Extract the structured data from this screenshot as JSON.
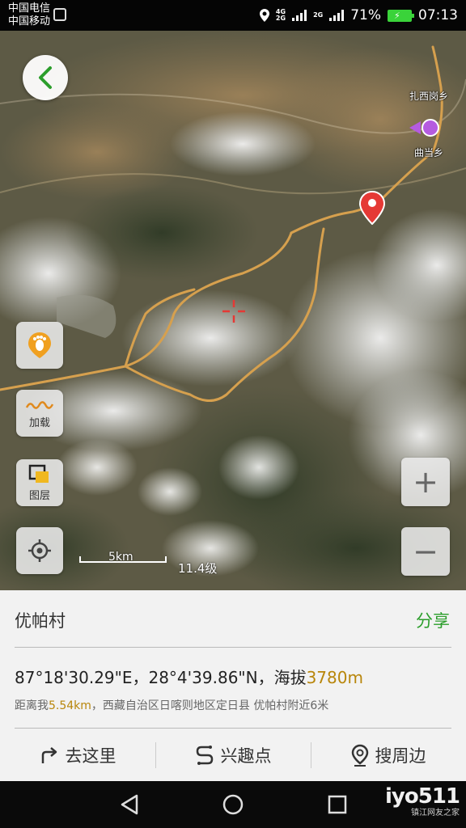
{
  "status_bar": {
    "carrier1": "中国电信",
    "carrier2": "中国移动",
    "network1": "4G",
    "network1b": "2G",
    "network2": "2G",
    "battery_percent": "71%",
    "time": "07:13"
  },
  "map": {
    "labels": {
      "town1": "扎西岗乡",
      "town2": "曲当乡"
    },
    "scale_label": "5km",
    "zoom_level": "11.4级",
    "buttons": {
      "load_label": "加载",
      "layers_label": "图层"
    },
    "zoom_in": "+",
    "zoom_out": "−"
  },
  "info_panel": {
    "place_name": "优帕村",
    "share_label": "分享",
    "coordinates": "87°18'30.29\"E，28°4'39.86\"N，",
    "altitude_label": "海拔",
    "altitude_value": "3780m",
    "distance_prefix": "距离我",
    "distance_value": "5.54km",
    "location_desc": "，西藏自治区日喀则地区定日县 优帕村附近6米"
  },
  "actions": {
    "go_here": "去这里",
    "poi": "兴趣点",
    "search_nearby": "搜周边"
  },
  "watermark": {
    "main": "iyo511",
    "sub": "镇江网友之家"
  },
  "icons": {
    "back": "chevron-left-icon",
    "footprint": "footprint-icon",
    "load": "wave-icon",
    "layers": "layers-icon",
    "locate": "locate-icon",
    "marker": "map-pin-icon",
    "crosshair": "crosshair-icon"
  },
  "colors": {
    "accent_green": "#2c9e2c",
    "highlight_gold": "#b8860b",
    "route": "#d6a04e",
    "marker_red": "#e53935"
  }
}
